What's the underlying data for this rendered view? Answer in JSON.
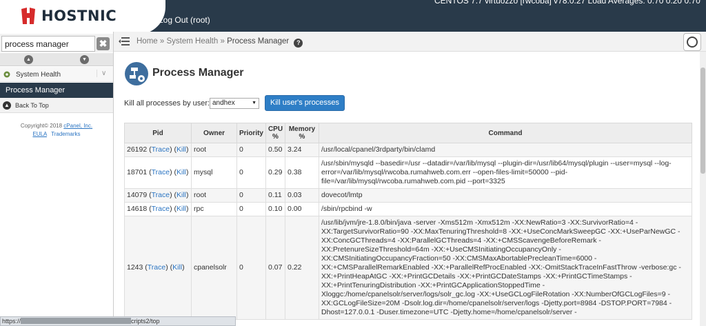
{
  "topbar": {
    "logout": "Log Out (root)",
    "server_info": "CENTOS 7.7 virtuozzo [rwcoba]    v78.0.27    Load Averages: 0.70 0.20 0.70"
  },
  "brand": {
    "name": "HOSTNIC",
    "color": "#d62b2b"
  },
  "sidebar": {
    "search_value": "process manager",
    "clear_label": "✖",
    "up_icon": "▲",
    "down_icon": "▼",
    "section_label": "System Health",
    "section_chevron": "∨",
    "active_item": "Process Manager",
    "back_to_top": "Back To Top",
    "copyright": "Copyright© 2018",
    "copyright_link": "cPanel, Inc.",
    "eula": "EULA",
    "trademarks": "Trademarks"
  },
  "breadcrumb": {
    "home": "Home",
    "sep": " » ",
    "section": "System Health",
    "current": "Process Manager",
    "help": "?"
  },
  "page": {
    "title": "Process Manager",
    "kill_label": "Kill all processes by user:",
    "selected_user": "andhex",
    "kill_button": "Kill user's processes"
  },
  "table": {
    "headers": [
      "Pid",
      "Owner",
      "Priority",
      "CPU %",
      "Memory %",
      "Command"
    ],
    "trace_label": "Trace",
    "kill_label": "Kill",
    "rows": [
      {
        "pid": "26192",
        "owner": "root",
        "priority": "0",
        "cpu": "0.50",
        "mem": "3.24",
        "command": "/usr/local/cpanel/3rdparty/bin/clamd"
      },
      {
        "pid": "18701",
        "owner": "mysql",
        "priority": "0",
        "cpu": "0.29",
        "mem": "0.38",
        "command": "/usr/sbin/mysqld --basedir=/usr --datadir=/var/lib/mysql --plugin-dir=/usr/lib64/mysql/plugin --user=mysql --log-error=/var/lib/mysql/rwcoba.rumahweb.com.err --open-files-limit=50000 --pid-file=/var/lib/mysql/rwcoba.rumahweb.com.pid --port=3325"
      },
      {
        "pid": "14079",
        "owner": "root",
        "priority": "0",
        "cpu": "0.11",
        "mem": "0.03",
        "command": "dovecot/lmtp"
      },
      {
        "pid": "14618",
        "owner": "rpc",
        "priority": "0",
        "cpu": "0.10",
        "mem": "0.00",
        "command": "/sbin/rpcbind -w"
      },
      {
        "pid": "1243",
        "owner": "cpanelsolr",
        "priority": "0",
        "cpu": "0.07",
        "mem": "0.22",
        "command": "/usr/lib/jvm/jre-1.8.0/bin/java -server -Xms512m -Xmx512m -XX:NewRatio=3 -XX:SurvivorRatio=4 -XX:TargetSurvivorRatio=90 -XX:MaxTenuringThreshold=8 -XX:+UseConcMarkSweepGC -XX:+UseParNewGC -XX:ConcGCThreads=4 -XX:ParallelGCThreads=4 -XX:+CMSScavengeBeforeRemark -XX:PretenureSizeThreshold=64m -XX:+UseCMSInitiatingOccupancyOnly -XX:CMSInitiatingOccupancyFraction=50 -XX:CMSMaxAbortablePrecleanTime=6000 -XX:+CMSParallelRemarkEnabled -XX:+ParallelRefProcEnabled -XX:-OmitStackTraceInFastThrow -verbose:gc -XX:+PrintHeapAtGC -XX:+PrintGCDetails -XX:+PrintGCDateStamps -XX:+PrintGCTimeStamps -XX:+PrintTenuringDistribution -XX:+PrintGCApplicationStoppedTime -Xloggc:/home/cpanelsolr/server/logs/solr_gc.log -XX:+UseGCLogFileRotation -XX:NumberOfGCLogFiles=9 -XX:GCLogFileSize=20M -Dsolr.log.dir=/home/cpanelsolr/server/logs -Djetty.port=8984 -DSTOP.PORT=7984 -Dhost=127.0.0.1 -Duser.timezone=UTC -Djetty.home=/home/cpanelsolr/server -"
      }
    ]
  },
  "statusbar": {
    "prefix": "https://",
    "suffix": "cripts2/top"
  }
}
